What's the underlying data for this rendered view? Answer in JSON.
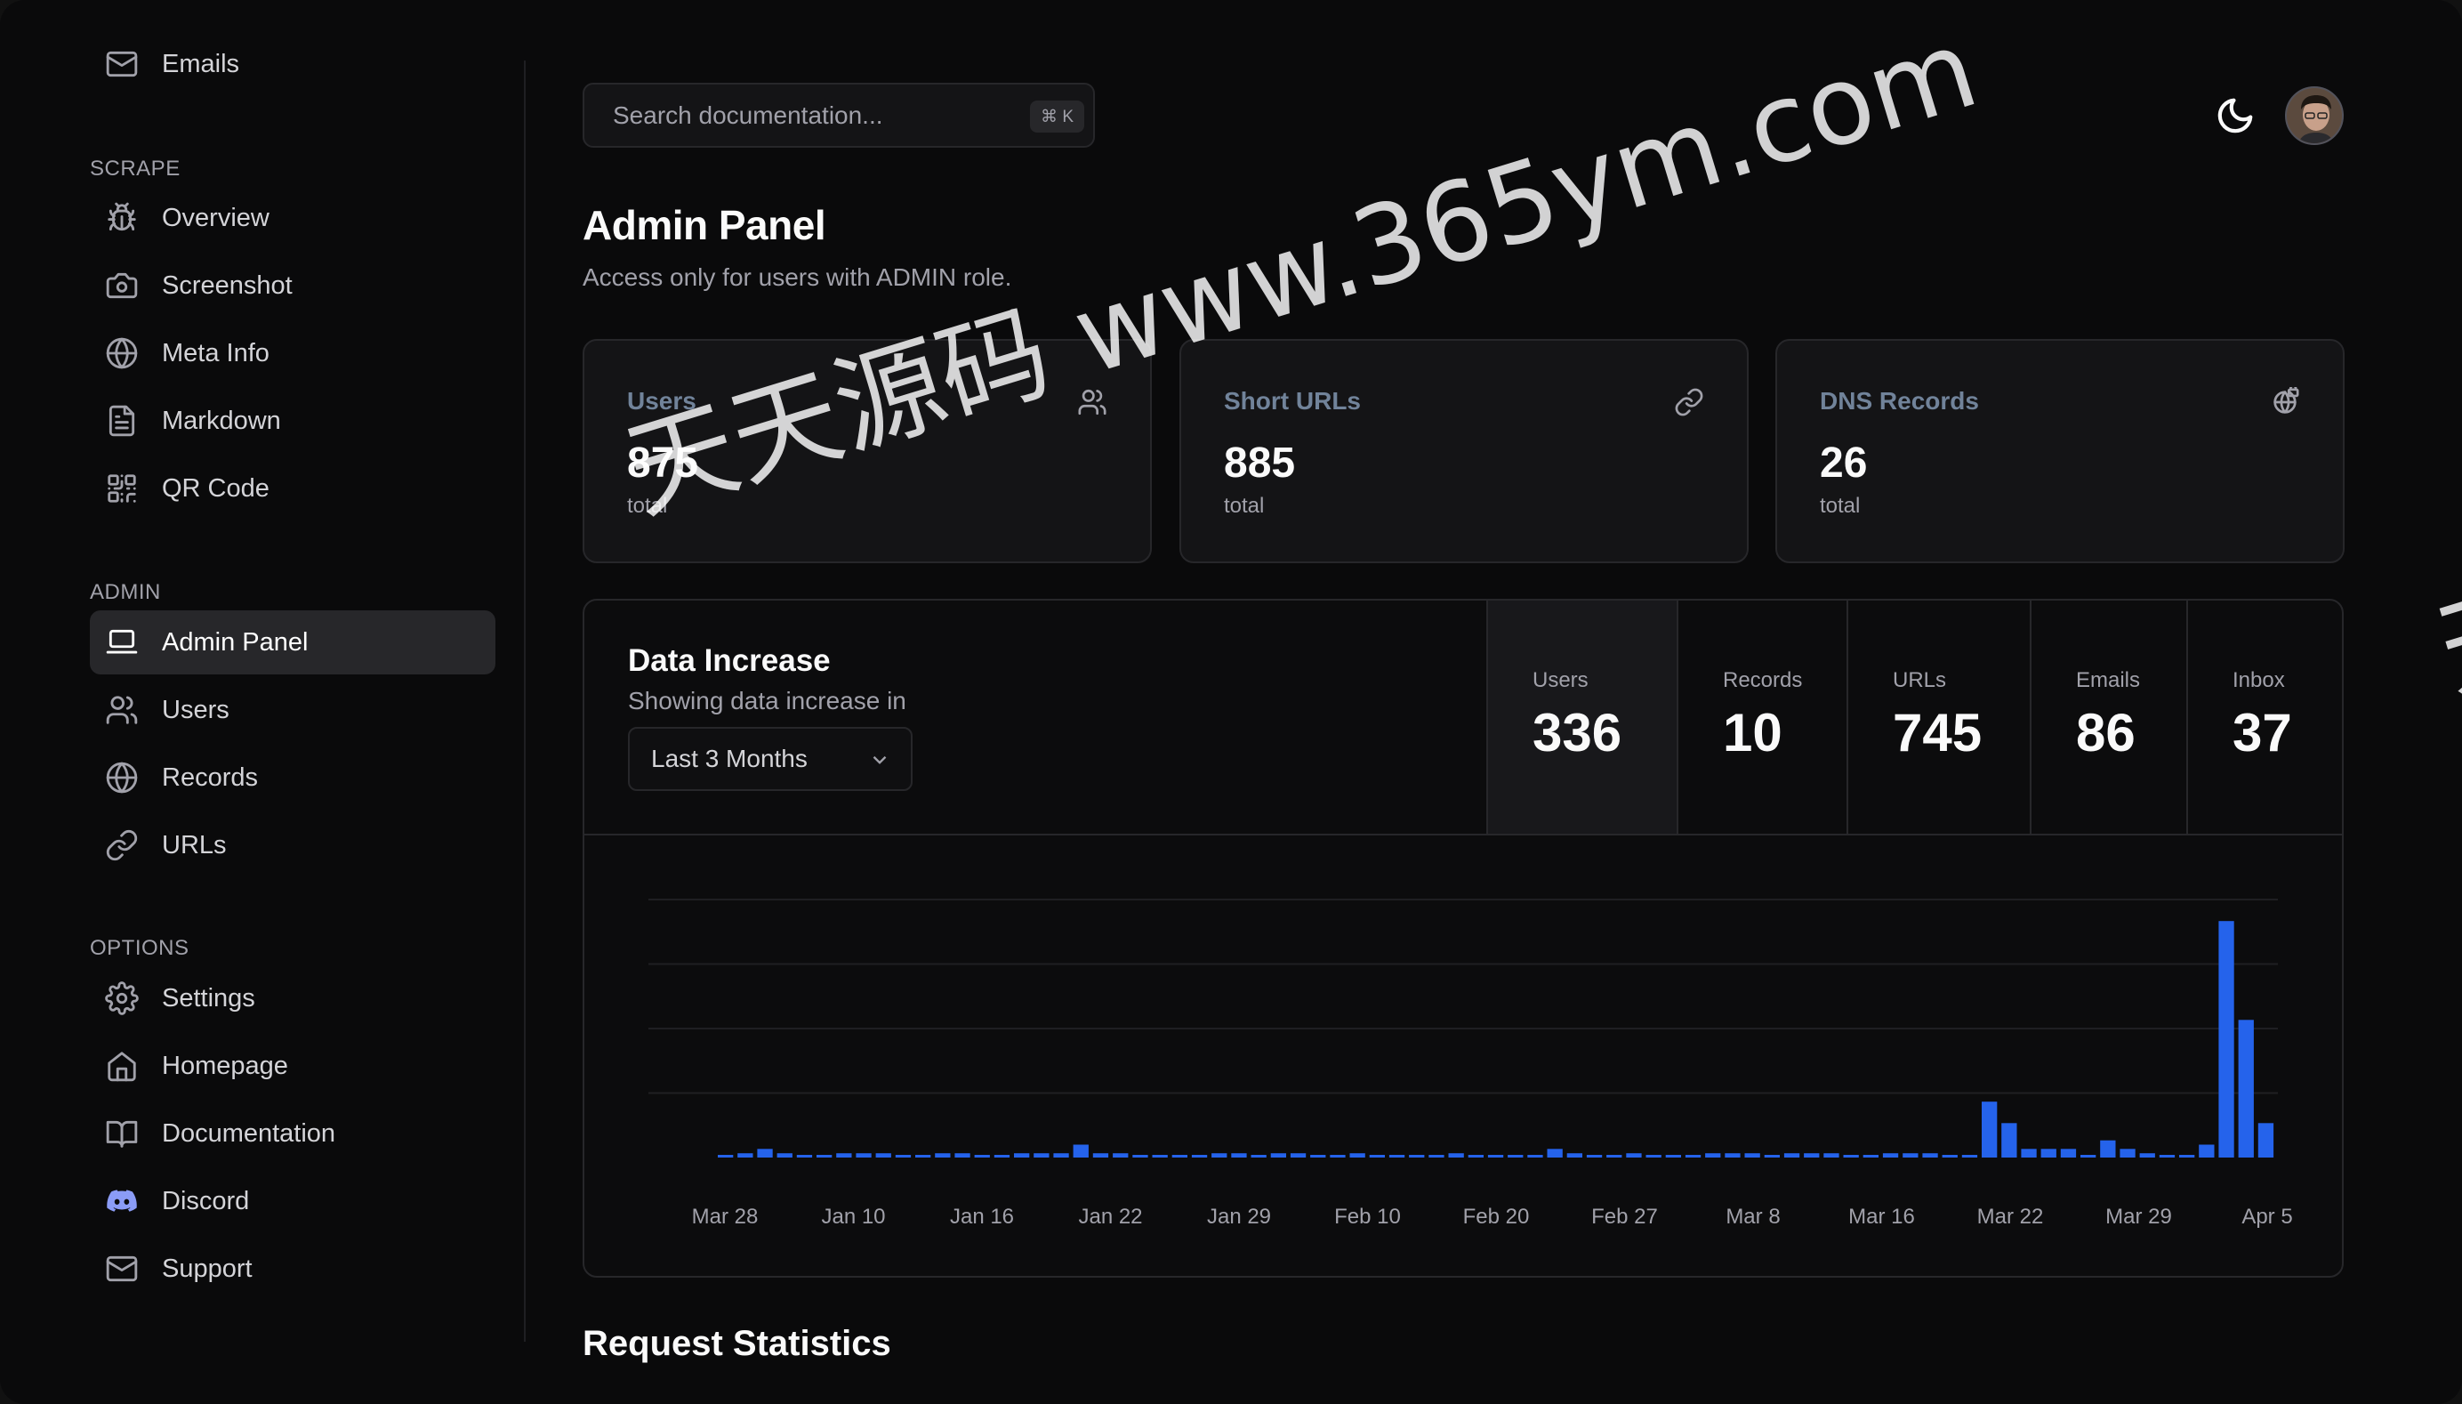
{
  "sidebar": {
    "top_item": {
      "label": "Emails",
      "icon": "mail-icon"
    },
    "sections": [
      {
        "title": "SCRAPE",
        "items": [
          {
            "label": "Overview",
            "icon": "bug-icon"
          },
          {
            "label": "Screenshot",
            "icon": "camera-icon"
          },
          {
            "label": "Meta Info",
            "icon": "globe-icon"
          },
          {
            "label": "Markdown",
            "icon": "file-text-icon"
          },
          {
            "label": "QR Code",
            "icon": "qr-code-icon"
          }
        ]
      },
      {
        "title": "ADMIN",
        "items": [
          {
            "label": "Admin Panel",
            "icon": "laptop-icon",
            "active": true
          },
          {
            "label": "Users",
            "icon": "users-icon"
          },
          {
            "label": "Records",
            "icon": "globe-icon"
          },
          {
            "label": "URLs",
            "icon": "link-icon"
          }
        ]
      },
      {
        "title": "OPTIONS",
        "items": [
          {
            "label": "Settings",
            "icon": "gear-icon"
          },
          {
            "label": "Homepage",
            "icon": "home-icon"
          },
          {
            "label": "Documentation",
            "icon": "book-icon"
          },
          {
            "label": "Discord",
            "icon": "discord-icon"
          },
          {
            "label": "Support",
            "icon": "mail-icon"
          }
        ]
      }
    ]
  },
  "topbar": {
    "search_placeholder": "Search documentation...",
    "shortcut": "⌘ K",
    "theme_icon": "moon-icon"
  },
  "header": {
    "title": "Admin Panel",
    "subtitle": "Access only for users with ADMIN role."
  },
  "cards": [
    {
      "title": "Users",
      "value": "875",
      "sub": "total",
      "icon": "users-icon"
    },
    {
      "title": "Short URLs",
      "value": "885",
      "sub": "total",
      "icon": "link-icon"
    },
    {
      "title": "DNS Records",
      "value": "26",
      "sub": "total",
      "icon": "globe-lock-icon"
    }
  ],
  "panel": {
    "title": "Data Increase",
    "description": "Showing data increase in",
    "range_select": "Last 3 Months",
    "stats": [
      {
        "label": "Users",
        "value": "336",
        "active": true
      },
      {
        "label": "Records",
        "value": "10"
      },
      {
        "label": "URLs",
        "value": "745"
      },
      {
        "label": "Emails",
        "value": "86"
      },
      {
        "label": "Inbox",
        "value": "37"
      }
    ]
  },
  "chart_data": {
    "type": "bar",
    "x_tick_labels": [
      "Mar 28",
      "Jan 10",
      "Jan 16",
      "Jan 22",
      "Jan 29",
      "Feb 10",
      "Feb 20",
      "Feb 27",
      "Mar 8",
      "Mar 16",
      "Mar 22",
      "Mar 29",
      "Apr 5"
    ],
    "values": [
      0,
      1,
      2,
      1,
      0,
      0,
      1,
      1,
      1,
      0,
      0,
      1,
      1,
      0,
      0,
      1,
      1,
      1,
      3,
      1,
      1,
      0,
      0,
      0,
      0,
      1,
      1,
      0,
      1,
      1,
      0,
      0,
      1,
      0,
      0,
      0,
      0,
      1,
      0,
      0,
      0,
      0,
      2,
      1,
      0,
      0,
      1,
      0,
      0,
      0,
      1,
      1,
      1,
      0,
      1,
      1,
      1,
      0,
      0,
      1,
      1,
      1,
      0,
      0,
      13,
      8,
      2,
      2,
      2,
      0,
      4,
      2,
      1,
      0,
      0,
      3,
      55,
      32,
      8
    ],
    "ylim": [
      0,
      60
    ],
    "gridlines": 4,
    "color": "#2563eb"
  },
  "next_section": {
    "title": "Request Statistics"
  },
  "watermark": {
    "text": "天天源码 www.365ym.com",
    "edge": "天"
  }
}
